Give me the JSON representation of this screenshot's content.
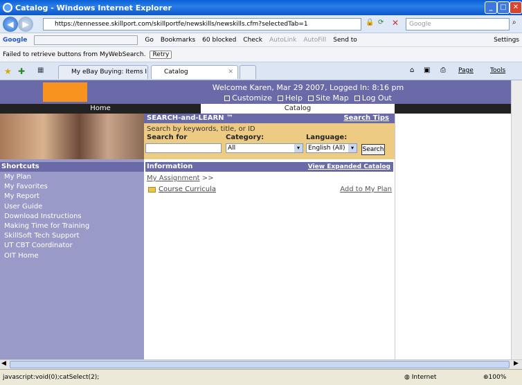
{
  "window": {
    "title": "Catalog - Windows Internet Explorer"
  },
  "address": {
    "url": "https://tennessee.skillport.com/skillportfe/newskills/newskills.cfm?selectedTab=1",
    "search_placeholder": "Google"
  },
  "google_toolbar": {
    "logo": "Google",
    "go_label": "Go",
    "bookmarks": "Bookmarks",
    "blocked": "60 blocked",
    "check": "Check",
    "autolink": "AutoLink",
    "autofill": "AutoFill",
    "send_to": "Send to",
    "settings": "Settings"
  },
  "mywebsearch": {
    "message": "Failed to retrieve buttons from MyWebSearch.",
    "retry": "Retry"
  },
  "tabs": [
    {
      "label": "My eBay Buying: Items I'm Bi..."
    },
    {
      "label": "Catalog"
    }
  ],
  "command_bar": {
    "page": "Page",
    "tools": "Tools"
  },
  "header": {
    "welcome": "Welcome Karen, Mar 29 2007, Logged In: 8:16 pm",
    "links": [
      "Customize",
      "Help",
      "Site Map",
      "Log Out"
    ]
  },
  "nav": {
    "home": "Home",
    "catalog": "Catalog"
  },
  "search": {
    "title": "SEARCH-and-LEARN ™",
    "tips": "Search Tips",
    "hint": "Search by keywords, title, or ID",
    "search_for_label": "Search for",
    "search_for_value": "",
    "category_label": "Category:",
    "category_value": "All",
    "language_label": "Language:",
    "language_value": "English (All)",
    "button": "Search"
  },
  "sidebar": {
    "heading": "Shortcuts",
    "items": [
      "My Plan",
      "My Favorites",
      "My Report",
      "User Guide",
      "Download Instructions",
      "Making Time for Training",
      "SkillSoft Tech Support",
      "UT CBT Coordinator",
      "OIT Home"
    ]
  },
  "info": {
    "heading": "Information",
    "expanded": "View Expanded Catalog",
    "breadcrumb_link": "My Assignment",
    "breadcrumb_sep": ">>",
    "folder_label": "Course Curricula",
    "add_to_plan": "Add to My Plan"
  },
  "status": {
    "text": "javascript:void(0);catSelect(2);",
    "zone": "Internet",
    "zoom": "100%"
  },
  "colors": {
    "header_purple": "#6a6aa8",
    "sidebar_purple": "#9a9ac8",
    "search_tan": "#eecb82",
    "ut_orange": "#f7931e"
  }
}
